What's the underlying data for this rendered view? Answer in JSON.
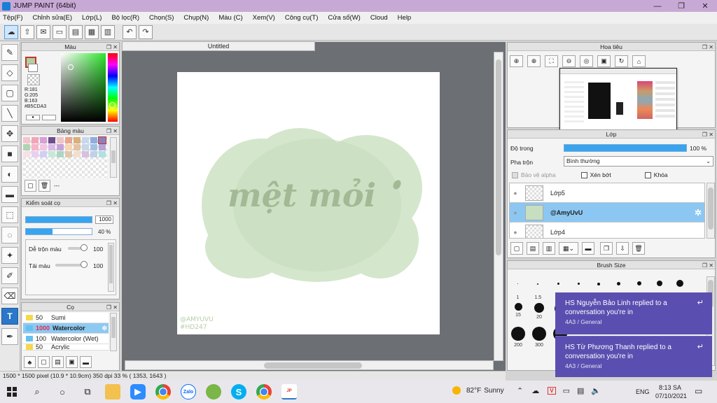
{
  "window": {
    "title": "JUMP PAINT (64bit)",
    "controls": [
      "—",
      "❐",
      "✕"
    ]
  },
  "menu": [
    "Tệp(F)",
    "Chỉnh sửa(E)",
    "Lớp(L)",
    "Bộ lọc(R)",
    "Chọn(S)",
    "Chụp(N)",
    "Màu (C)",
    "Xem(V)",
    "Công cụ(T)",
    "Cửa sổ(W)",
    "Cloud",
    "Help"
  ],
  "canvas": {
    "tab_label": "Untitled",
    "artwork_text": "mệt mỏi",
    "watermark_1": "@AMYUVU",
    "watermark_2": "#HD247"
  },
  "color_panel": {
    "title": "Màu",
    "r": "R:181",
    "g": "G:205",
    "b": "B:163",
    "hex": "#B5CDA3",
    "main_color": "#b5cda3"
  },
  "palette_panel": {
    "title": "Bảng màu",
    "footer_text": "---",
    "swatches": [
      "#f3c7cf",
      "#f2a5b5",
      "#d7a0d6",
      "#6e4e8c",
      "#f0c4c9",
      "#e8a58f",
      "#d7b07c",
      "#c8d7f0",
      "#8faedd",
      "#8c7fbf",
      "#b0d4b0",
      "#f4b6c8",
      "#f2c6e2",
      "#d9b9e6",
      "#c7a2d8",
      "#f5d7b5",
      "#e3c3a3",
      "#c4d8e8",
      "#a3c2e2",
      "#b5a5d8",
      "#f8e0e6",
      "#e8d0f0",
      "#d0d0f5",
      "#c8e8d8",
      "#a8d8c0",
      "#e0c8b0",
      "#f0e0d0",
      "#d8c0e0",
      "#c0d0e8",
      "#b0e0e0"
    ]
  },
  "brush_control": {
    "title": "Kiểm soát cọ",
    "size_value": "1000",
    "opacity_value": "40 %",
    "blend_label": "Dễ trộn màu",
    "blend_value": "100",
    "color_amount_label": "Tải màu",
    "color_amount_value": "100"
  },
  "brush_list": {
    "title": "Cọ",
    "items": [
      {
        "size": "50",
        "name": "Sumi",
        "color": "#f7d84a"
      },
      {
        "size": "1000",
        "name": "Watercolor",
        "color": "#63c1f2",
        "selected": "true"
      },
      {
        "size": "100",
        "name": "Watercolor (Wet)",
        "color": "#63c1f2"
      },
      {
        "size": "50",
        "name": "Acrylic",
        "color": "#f7d84a"
      }
    ]
  },
  "navigator": {
    "title": "Hoa tiêu"
  },
  "layer_panel": {
    "title": "Lớp",
    "opacity_label": "Độ trong",
    "opacity_value": "100 %",
    "opacity_fraction": 1.0,
    "blend_label": "Pha trộn",
    "blend_value": "Bình thường",
    "protect_alpha": "Bảo vệ alpha",
    "clipping": "Xén bớt",
    "lock": "Khóa",
    "layers": [
      {
        "name": "Lớp5",
        "selected": "false"
      },
      {
        "name": "@AmyUvU",
        "selected": "true"
      },
      {
        "name": "Lớp4",
        "selected": "false"
      }
    ]
  },
  "brush_size": {
    "title": "Brush Size",
    "row1_labels": [
      "1",
      "1.5",
      "",
      "",
      "",
      "",
      "",
      "",
      ""
    ],
    "row2_labels": [
      "15",
      "20",
      "",
      "",
      "",
      "",
      "",
      "",
      ""
    ],
    "row3_labels": [
      "200",
      "300",
      "",
      "",
      "",
      "",
      "",
      "",
      ""
    ]
  },
  "status": {
    "text": "1500 * 1500 pixel   (10.9 * 10.9cm)   350 dpi   33 %   ( 1353, 1643 )"
  },
  "notifications": [
    {
      "title": "HS Nguyễn Bảo Linh replied to a conversation you're in",
      "sub": "4A3 / General"
    },
    {
      "title": "HS Từ Phương Thanh replied to a conversation you're in",
      "sub": "4A3 / General"
    }
  ],
  "taskbar": {
    "weather_temp": "82°F",
    "weather_text": "Sunny",
    "lang": "ENG",
    "time": "8:13 SA",
    "date": "07/10/2021"
  }
}
